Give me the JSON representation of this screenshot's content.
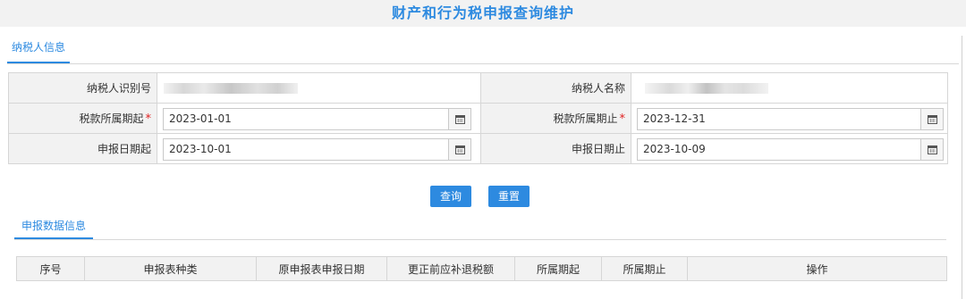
{
  "page": {
    "title": "财产和行为税申报查询维护"
  },
  "taxpayer_tab": {
    "label": "纳税人信息"
  },
  "form": {
    "taxpayer_id_label": "纳税人识别号",
    "taxpayer_name_label": "纳税人名称",
    "tax_period_start_label": "税款所属期起",
    "tax_period_end_label": "税款所属期止",
    "filing_date_start_label": "申报日期起",
    "filing_date_end_label": "申报日期止",
    "required_mark": "*",
    "tax_period_start_value": "2023-01-01",
    "tax_period_end_value": "2023-12-31",
    "filing_date_start_value": "2023-10-01",
    "filing_date_end_value": "2023-10-09"
  },
  "buttons": {
    "query": "查询",
    "reset": "重置"
  },
  "filing_tab": {
    "label": "申报数据信息"
  },
  "results_table": {
    "columns": [
      "序号",
      "申报表种类",
      "原申报表申报日期",
      "更正前应补退税额",
      "所属期起",
      "所属期止",
      "操作"
    ]
  }
}
